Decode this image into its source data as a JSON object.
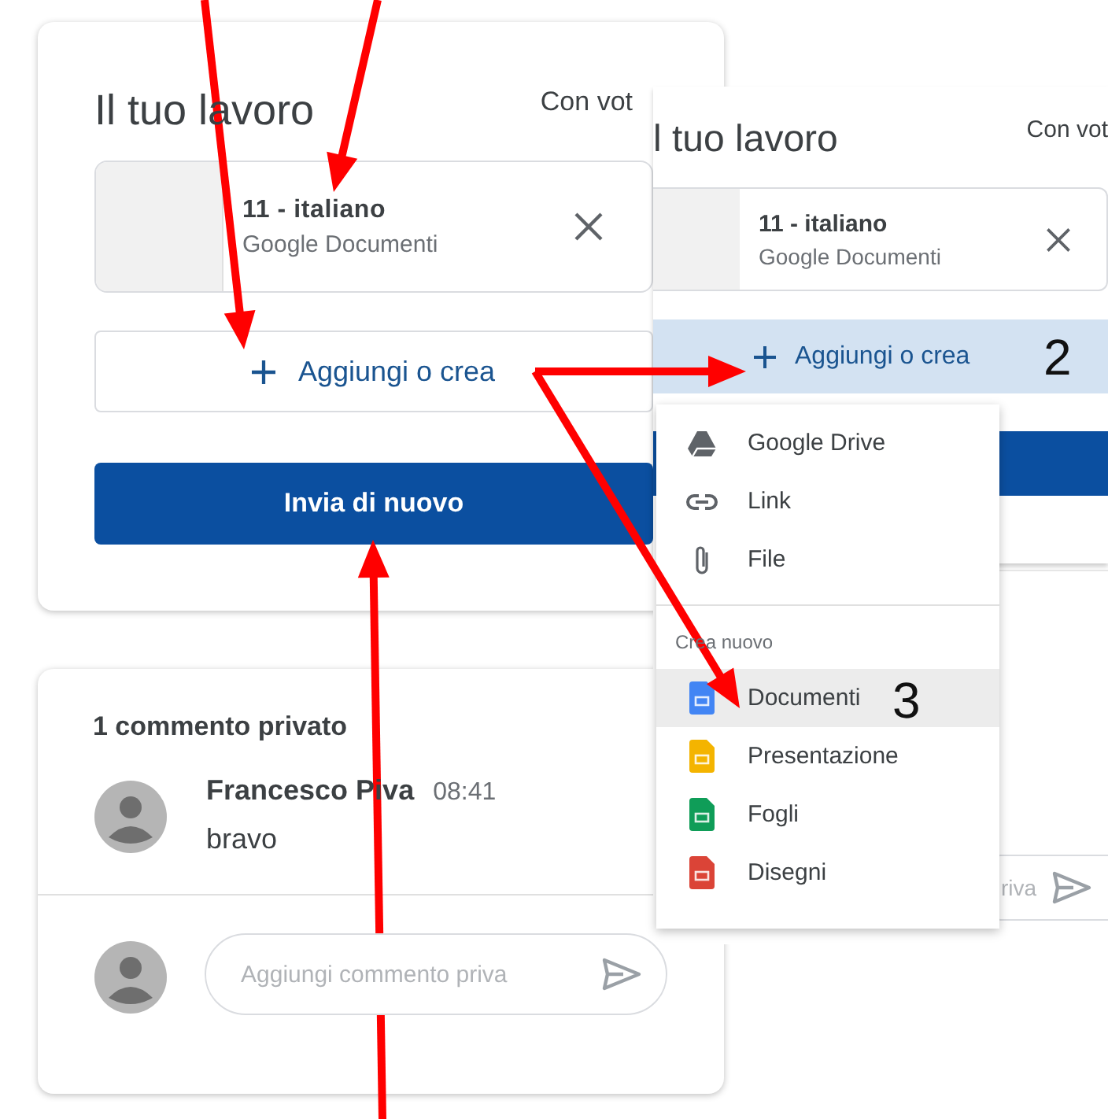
{
  "back_screen": {
    "title": "Il tuo lavoro",
    "grade_label": "Con vot",
    "attachment": {
      "name": "11 - italiano",
      "type": "Google Documenti"
    },
    "add_button": "Aggiungi o crea",
    "submit_button": "Invia di nuovo",
    "comments": {
      "heading": "1 commento privato",
      "items": [
        {
          "author": "Francesco Piva",
          "time": "08:41",
          "text": "bravo"
        }
      ],
      "input": {
        "placeholder": "Aggiungi commento priva"
      }
    }
  },
  "front_screen": {
    "title": "l tuo lavoro",
    "grade_label": "Con vot",
    "attachment": {
      "name": "11 - italiano",
      "type": "Google Documenti"
    },
    "add_button": {
      "label": "Aggiungi o crea",
      "selected": true,
      "step": "2"
    },
    "menu": {
      "items": [
        {
          "kind": "drive",
          "label": "Google Drive",
          "selected": false
        },
        {
          "kind": "link",
          "label": "Link",
          "selected": false
        },
        {
          "kind": "file",
          "label": "File",
          "selected": false
        }
      ],
      "section": "Crea nuovo",
      "create_items": [
        {
          "kind": "docs",
          "label": "Documenti",
          "selected": true,
          "step": "3"
        },
        {
          "kind": "slides",
          "label": "Presentazione",
          "selected": false
        },
        {
          "kind": "sheets",
          "label": "Fogli",
          "selected": false
        },
        {
          "kind": "drawings",
          "label": "Disegni",
          "selected": false
        }
      ]
    },
    "comment_input": {
      "placeholder": "riva"
    }
  }
}
